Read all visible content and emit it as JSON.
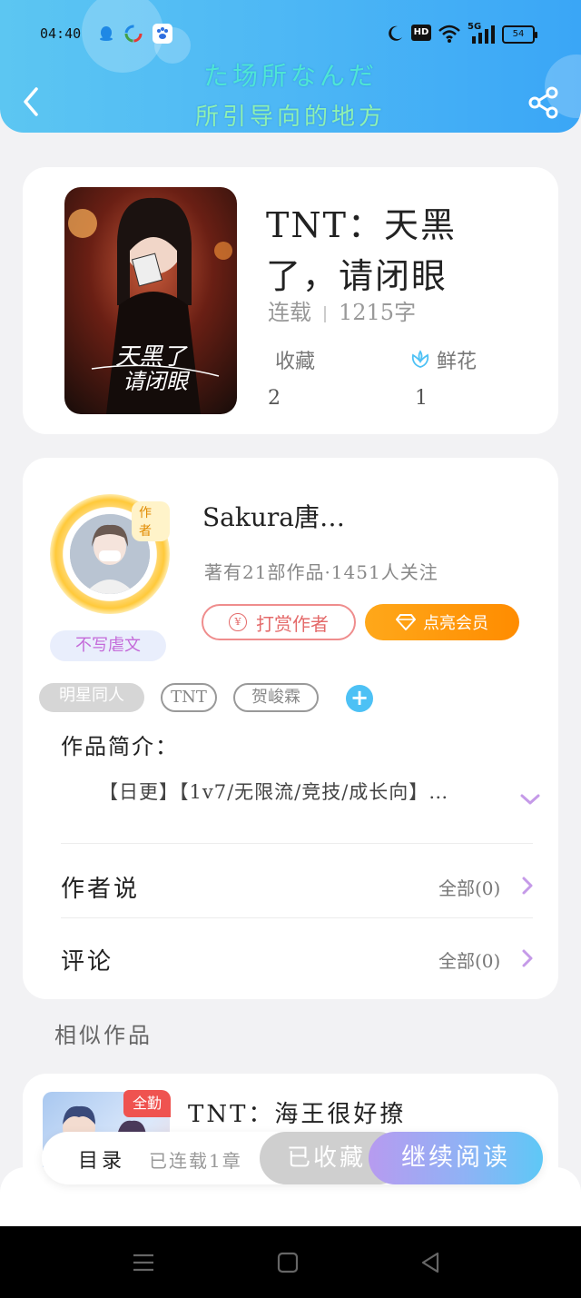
{
  "status_bar": {
    "time": "04:40",
    "network": "5G",
    "hd": "HD",
    "battery": "54"
  },
  "header": {
    "slogan_line1": "た场所なんだ",
    "slogan_line2": "所引导向的地方"
  },
  "book": {
    "title": "TNT：天黑了，请闭眼",
    "status": "连载",
    "word_count": "1215字",
    "favorites_label": "收藏",
    "favorites_count": "2",
    "flowers_label": "鲜花",
    "flowers_count": "1"
  },
  "author": {
    "avatar_tag": "作者",
    "name": "Sakura唐…",
    "stats": "著有21部作品·1451人关注",
    "badge": "不写虐文",
    "tip_label": "打赏作者",
    "vip_label": "点亮会员"
  },
  "tags": [
    "明星同人",
    "TNT",
    "贺峻霖"
  ],
  "intro": {
    "label": "作品简介：",
    "text": "【日更】【1v7/无限流/竞技/成长向】…"
  },
  "rows": {
    "author_says": "作者说",
    "author_says_more": "全部(0)",
    "comments": "评论",
    "comments_more": "全部(0)"
  },
  "similar": {
    "section_title": "相似作品",
    "items": [
      {
        "badge": "全勤",
        "title": "TNT：海王很好撩"
      }
    ]
  },
  "bottom_bar": {
    "catalog": "目录",
    "chapters": "已连载1章",
    "favorited": "已收藏",
    "continue": "继续阅读"
  },
  "colors": {
    "header_gradient_start": "#5cc6f2",
    "header_gradient_end": "#3aa6f6",
    "vip_orange": "#ff8c00",
    "tip_red": "#e46a6a",
    "read_gradient_end": "#5ec8f6"
  },
  "icons": [
    "back-arrow-icon",
    "share-icon",
    "flower-icon",
    "coin-icon",
    "diamond-icon",
    "plus-icon",
    "chevron-down-icon",
    "chevron-right-icon"
  ]
}
